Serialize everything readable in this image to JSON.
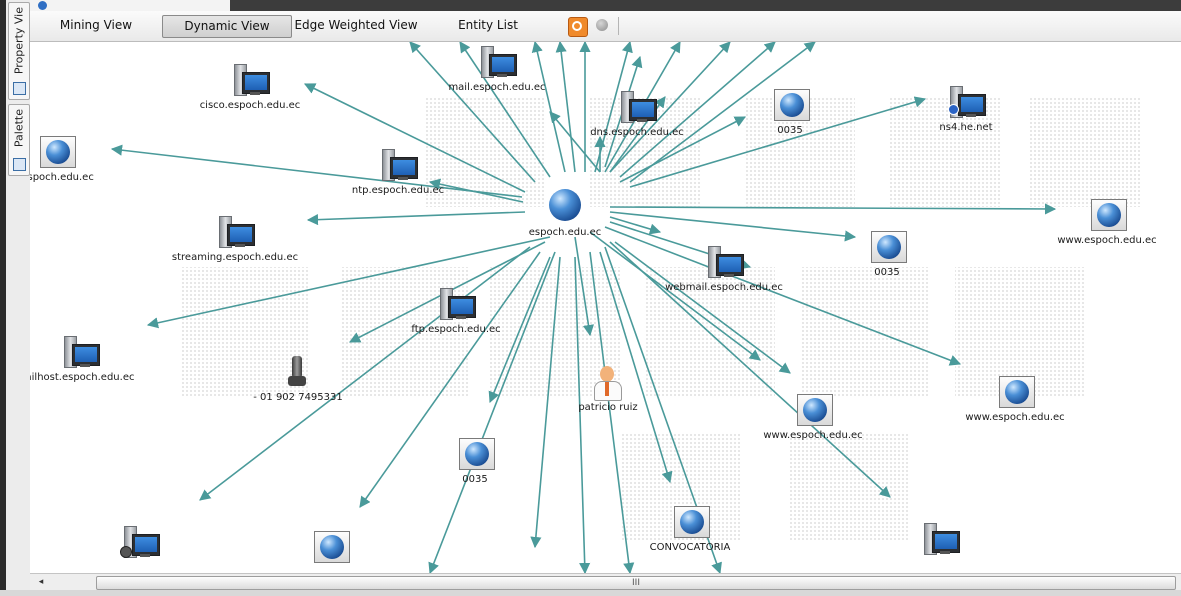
{
  "side_tabs": [
    {
      "label": "Property Vie",
      "icon": "property-view-icon"
    },
    {
      "label": "Palette",
      "icon": "palette-icon"
    }
  ],
  "toolbar": {
    "views": [
      {
        "label": "Mining View",
        "active": false
      },
      {
        "label": "Dynamic View",
        "active": true
      },
      {
        "label": "Edge Weighted View",
        "active": false
      },
      {
        "label": "Entity List",
        "active": false
      }
    ],
    "icons": [
      "layout-settings-icon",
      "status-circle-icon"
    ]
  },
  "graph": {
    "edge_color": "#4a9a9a",
    "center": {
      "label": "espoch.edu.ec",
      "icon": "domain-globe-icon"
    },
    "nodes": [
      {
        "id": "cisco",
        "label": "cisco.espoch.edu.ec",
        "icon": "server-icon"
      },
      {
        "id": "mail",
        "label": "mail.espoch.edu.ec",
        "icon": "server-icon"
      },
      {
        "id": "dns",
        "label": "dns.espoch.edu.ec",
        "icon": "server-icon"
      },
      {
        "id": "ip1",
        "label": "0035",
        "icon": "website-icon"
      },
      {
        "id": "ns4",
        "label": "ns4.he.net",
        "icon": "nameserver-icon"
      },
      {
        "id": "espoch-left",
        "label": ".espoch.edu.ec",
        "icon": "website-icon"
      },
      {
        "id": "ntp",
        "label": "ntp.espoch.edu.ec",
        "icon": "server-icon"
      },
      {
        "id": "www1",
        "label": "www.espoch.edu.ec",
        "icon": "website-icon"
      },
      {
        "id": "streaming",
        "label": "streaming.espoch.edu.ec",
        "icon": "server-icon"
      },
      {
        "id": "ip2",
        "label": "0035",
        "icon": "website-icon"
      },
      {
        "id": "webmail",
        "label": "webmail.espoch.edu.ec",
        "icon": "server-icon"
      },
      {
        "id": "ftp",
        "label": "ftp.espoch.edu.ec",
        "icon": "server-icon"
      },
      {
        "id": "mailhost",
        "label": "ailhost.espoch.edu.ec",
        "icon": "server-icon"
      },
      {
        "id": "phone",
        "label": "- 01 902 7495331",
        "icon": "phone-icon"
      },
      {
        "id": "person",
        "label": "patricio ruiz",
        "icon": "person-icon"
      },
      {
        "id": "www2",
        "label": "www.espoch.edu.ec",
        "icon": "website-icon"
      },
      {
        "id": "www3",
        "label": "www.espoch.edu.ec",
        "icon": "website-icon"
      },
      {
        "id": "ip3",
        "label": "0035",
        "icon": "website-icon"
      },
      {
        "id": "convocatoria",
        "label": "CONVOCATORIA",
        "icon": "website-icon"
      },
      {
        "id": "bottom-left",
        "label": "",
        "icon": "mx-server-icon"
      },
      {
        "id": "bottom-mid",
        "label": "",
        "icon": "website-icon"
      },
      {
        "id": "bottom-right",
        "label": "",
        "icon": "server-icon"
      }
    ]
  },
  "scrollbar": {
    "left_arrow": "◂",
    "grip": "III"
  }
}
